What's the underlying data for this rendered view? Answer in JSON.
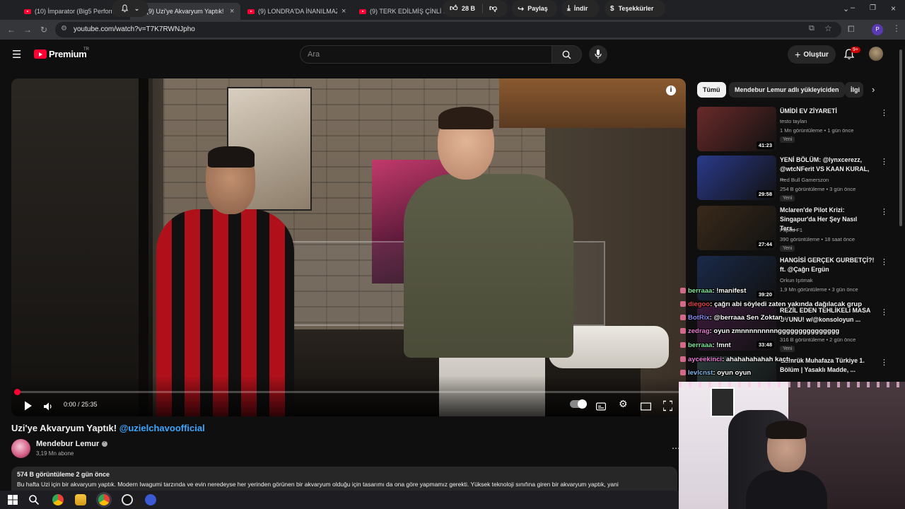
{
  "browser": {
    "tabs": [
      {
        "title": "(10) İmparator (Big5 Performans",
        "active": false
      },
      {
        "title": "(9) Uzi'ye Akvaryum Yaptık! @u",
        "active": true
      },
      {
        "title": "(9) LONDRA'DA İNANILMAZ SÜ",
        "active": false
      },
      {
        "title": "(9) TERK EDİLMİŞ ÇİNLİ KÖYDE",
        "active": false
      }
    ],
    "url": "youtube.com/watch?v=T7K7RWNJpho",
    "profile_letter": "P"
  },
  "header": {
    "logo_text": "Premium",
    "logo_region": "TR",
    "search_placeholder": "Ara",
    "create_label": "Oluştur",
    "notifications_badge": "9+"
  },
  "player": {
    "time": "0:00 / 25:35",
    "progress_fraction": 0.0
  },
  "video": {
    "title": "Uzi'ye Akvaryum Yaptık!",
    "title_handle": "@uzielchavoofficial",
    "channel_name": "Mendebur Lemur",
    "subscribers": "3,19 Mn abone",
    "likes": "28 B",
    "share_label": "Paylaş",
    "download_label": "İndir",
    "thanks_label": "Teşekkürler",
    "views_date": "574 B görüntüleme  2 gün önce",
    "description": "Bu hafta Uzi için bir akvaryum yaptık. Modern Iwagumi tarzında ve evin neredeyse her yerinden görünen bir akvaryum olduğu için tasarımı da ona göre yapmamız gerekti. Yüksek teknoloji sınıfına giren bir akvaryum yaptık, yani"
  },
  "sidebar": {
    "chips": [
      "Tümü",
      "Mendebur Lemur adlı yükleyiciden",
      "İlgi"
    ],
    "recommendations": [
      {
        "title": "ÜMİDİ EV ZİYARETİ",
        "channel": "testo taylan",
        "stats": "1 Mn görüntüleme • 1 gün önce",
        "badge": "Yeni",
        "duration": "41:23",
        "thumb_color": "#6a2a2a"
      },
      {
        "title": "YENİ BÖLÜM: @lynxcerezz, @wtcNFerit VS KAAN KURAL, ...",
        "channel": "Red Bull Gamerszon",
        "stats": "254 B görüntüleme • 3 gün önce",
        "badge": "Yeni",
        "duration": "29:58",
        "thumb_color": "#2a3a8a"
      },
      {
        "title": "Mclaren'de Pilot Krizi: Singapur'da Her Şey Nasıl Ters...",
        "channel": "Pitpod F1",
        "stats": "390 görüntüleme • 18 saat önce",
        "badge": "Yeni",
        "duration": "27:44",
        "thumb_color": "#3a2a1a"
      },
      {
        "title": "HANGİSİ GERÇEK GURBETÇİ?! ft. @Çağrı Ergün",
        "channel": "Orkun Işıtmak",
        "stats": "1,9 Mn görüntüleme • 3 gün önce",
        "badge": "",
        "duration": "39:20",
        "thumb_color": "#1a2a4a"
      },
      {
        "title": "REZİL EDEN TEHLİKELİ MASA OYUNU! w/@konsoloyun ...",
        "channel": "kanal",
        "stats": "316 B görüntüleme • 2 gün önce",
        "badge": "Yeni",
        "duration": "33:48",
        "thumb_color": "#3a1a3a"
      },
      {
        "title": "Gümrük Muhafaza Türkiye 1. Bölüm | Yasaklı Madde, ...",
        "channel": "",
        "stats": "",
        "badge": "",
        "duration": "",
        "thumb_color": "#2a3a3a"
      }
    ]
  },
  "chat": [
    {
      "user": "berraaa",
      "message": ": !manifest",
      "color": "#7fe39a"
    },
    {
      "user": "diegoo",
      "message": ": çağrı abi söyledi zaten yakında dağılacak grup",
      "color": "#e0404a"
    },
    {
      "user": "BotRix",
      "message": ": @berraaa Sen Zoktan...",
      "color": "#8a8af0"
    },
    {
      "user": "zedrag",
      "message": ": oyun zmnnnnnnnnnggggggggggggggg",
      "color": "#e87ad6"
    },
    {
      "user": "berraaa",
      "message": ": !mnt",
      "color": "#7fe39a"
    },
    {
      "user": "ayceekinci",
      "message": ": ahahahahahah kaçtı",
      "color": "#e87ad6"
    },
    {
      "user": "levlcnst",
      "message": ": oyun oyun",
      "color": "#7fb6e8"
    }
  ]
}
